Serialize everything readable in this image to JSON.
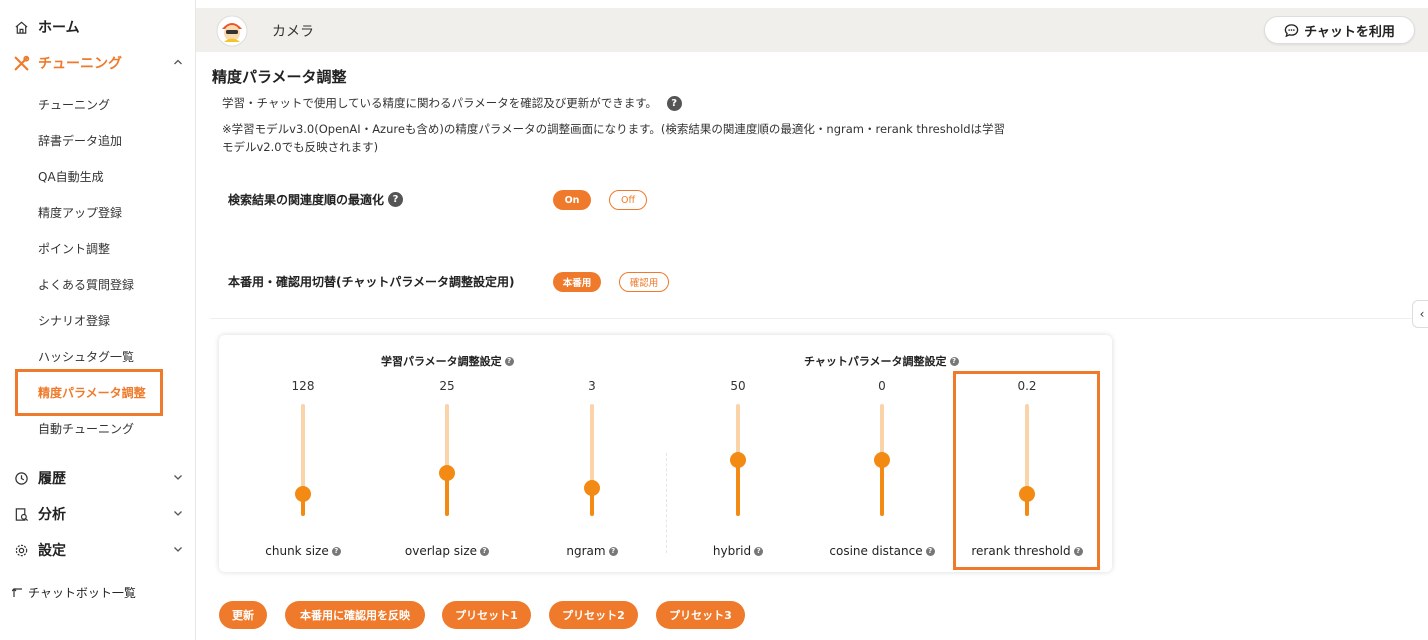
{
  "sidebar": {
    "home": "ホーム",
    "tuning": "チューニング",
    "tuning_items": [
      "チューニング",
      "辞書データ追加",
      "QA自動生成",
      "精度アップ登録",
      "ポイント調整",
      "よくある質問登録",
      "シナリオ登録",
      "ハッシュタグ一覧",
      "精度パラメータ調整",
      "自動チューニング"
    ],
    "active_item": "精度パラメータ調整",
    "history": "履歴",
    "analysis": "分析",
    "settings": "設定",
    "chatbot_list": "チャットボット一覧"
  },
  "header": {
    "bot_name": "カメラ",
    "chat_button": "チャットを利用"
  },
  "page": {
    "title": "精度パラメータ調整",
    "desc1": "学習・チャットで使用している精度に関わるパラメータを確認及び更新ができます。",
    "desc2_line1": "※学習モデルv3.0(OpenAI・Azureも含め)の精度パラメータの調整画面になります。(検索結果の関連度順の最適化・ngram・rerank thresholdは学習",
    "desc2_line2": "モデルv2.0でも反映されます)",
    "optimize_label": "検索結果の関連度順の最適化",
    "on_label": "On",
    "off_label": "Off",
    "switch_label": "本番用・確認用切替(チャットパラメータ調整設定用)",
    "prod_label": "本番用",
    "check_label": "確認用"
  },
  "params": {
    "learning_title": "学習パラメータ調整設定",
    "chat_title": "チャットパラメータ調整設定",
    "sliders": [
      {
        "label": "chunk size",
        "value": "128",
        "level": 0.2
      },
      {
        "label": "overlap size",
        "value": "25",
        "level": 0.38
      },
      {
        "label": "ngram",
        "value": "3",
        "level": 0.25
      },
      {
        "label": "hybrid",
        "value": "50",
        "level": 0.5
      },
      {
        "label": "cosine distance",
        "value": "0",
        "level": 0.5
      },
      {
        "label": "rerank threshold",
        "value": "0.2",
        "level": 0.2
      }
    ]
  },
  "buttons": {
    "update": "更新",
    "apply": "本番用に確認用を反映",
    "preset1": "プリセット1",
    "preset2": "プリセット2",
    "preset3": "プリセット3"
  },
  "colors": {
    "accent": "#ef7a2b",
    "slider_fill": "#f28a13",
    "slider_track": "#fbd3a9"
  }
}
